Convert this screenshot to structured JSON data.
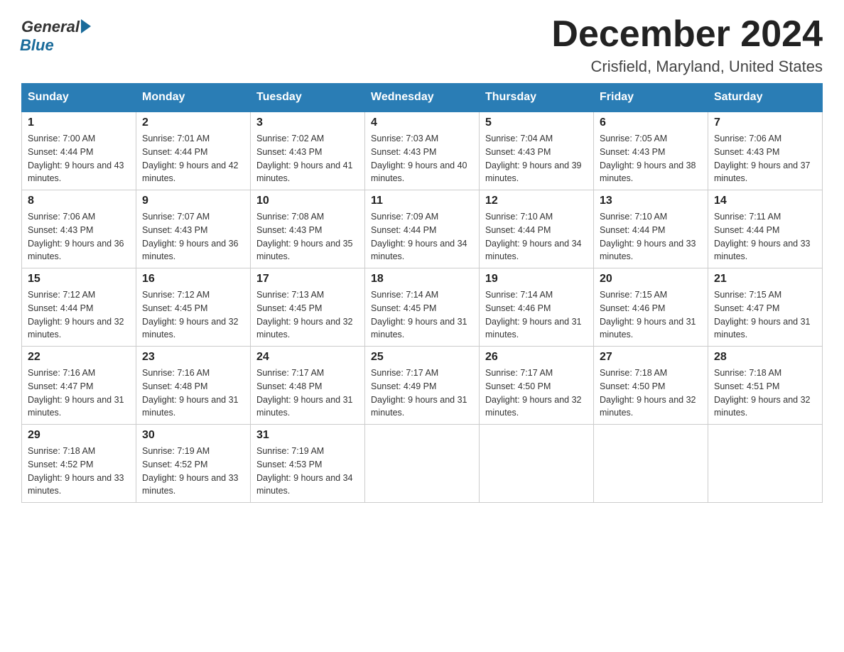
{
  "header": {
    "logo_general": "General",
    "logo_blue": "Blue",
    "month_title": "December 2024",
    "location": "Crisfield, Maryland, United States"
  },
  "days_of_week": [
    "Sunday",
    "Monday",
    "Tuesday",
    "Wednesday",
    "Thursday",
    "Friday",
    "Saturday"
  ],
  "weeks": [
    [
      {
        "day": "1",
        "sunrise": "7:00 AM",
        "sunset": "4:44 PM",
        "daylight": "9 hours and 43 minutes."
      },
      {
        "day": "2",
        "sunrise": "7:01 AM",
        "sunset": "4:44 PM",
        "daylight": "9 hours and 42 minutes."
      },
      {
        "day": "3",
        "sunrise": "7:02 AM",
        "sunset": "4:43 PM",
        "daylight": "9 hours and 41 minutes."
      },
      {
        "day": "4",
        "sunrise": "7:03 AM",
        "sunset": "4:43 PM",
        "daylight": "9 hours and 40 minutes."
      },
      {
        "day": "5",
        "sunrise": "7:04 AM",
        "sunset": "4:43 PM",
        "daylight": "9 hours and 39 minutes."
      },
      {
        "day": "6",
        "sunrise": "7:05 AM",
        "sunset": "4:43 PM",
        "daylight": "9 hours and 38 minutes."
      },
      {
        "day": "7",
        "sunrise": "7:06 AM",
        "sunset": "4:43 PM",
        "daylight": "9 hours and 37 minutes."
      }
    ],
    [
      {
        "day": "8",
        "sunrise": "7:06 AM",
        "sunset": "4:43 PM",
        "daylight": "9 hours and 36 minutes."
      },
      {
        "day": "9",
        "sunrise": "7:07 AM",
        "sunset": "4:43 PM",
        "daylight": "9 hours and 36 minutes."
      },
      {
        "day": "10",
        "sunrise": "7:08 AM",
        "sunset": "4:43 PM",
        "daylight": "9 hours and 35 minutes."
      },
      {
        "day": "11",
        "sunrise": "7:09 AM",
        "sunset": "4:44 PM",
        "daylight": "9 hours and 34 minutes."
      },
      {
        "day": "12",
        "sunrise": "7:10 AM",
        "sunset": "4:44 PM",
        "daylight": "9 hours and 34 minutes."
      },
      {
        "day": "13",
        "sunrise": "7:10 AM",
        "sunset": "4:44 PM",
        "daylight": "9 hours and 33 minutes."
      },
      {
        "day": "14",
        "sunrise": "7:11 AM",
        "sunset": "4:44 PM",
        "daylight": "9 hours and 33 minutes."
      }
    ],
    [
      {
        "day": "15",
        "sunrise": "7:12 AM",
        "sunset": "4:44 PM",
        "daylight": "9 hours and 32 minutes."
      },
      {
        "day": "16",
        "sunrise": "7:12 AM",
        "sunset": "4:45 PM",
        "daylight": "9 hours and 32 minutes."
      },
      {
        "day": "17",
        "sunrise": "7:13 AM",
        "sunset": "4:45 PM",
        "daylight": "9 hours and 32 minutes."
      },
      {
        "day": "18",
        "sunrise": "7:14 AM",
        "sunset": "4:45 PM",
        "daylight": "9 hours and 31 minutes."
      },
      {
        "day": "19",
        "sunrise": "7:14 AM",
        "sunset": "4:46 PM",
        "daylight": "9 hours and 31 minutes."
      },
      {
        "day": "20",
        "sunrise": "7:15 AM",
        "sunset": "4:46 PM",
        "daylight": "9 hours and 31 minutes."
      },
      {
        "day": "21",
        "sunrise": "7:15 AM",
        "sunset": "4:47 PM",
        "daylight": "9 hours and 31 minutes."
      }
    ],
    [
      {
        "day": "22",
        "sunrise": "7:16 AM",
        "sunset": "4:47 PM",
        "daylight": "9 hours and 31 minutes."
      },
      {
        "day": "23",
        "sunrise": "7:16 AM",
        "sunset": "4:48 PM",
        "daylight": "9 hours and 31 minutes."
      },
      {
        "day": "24",
        "sunrise": "7:17 AM",
        "sunset": "4:48 PM",
        "daylight": "9 hours and 31 minutes."
      },
      {
        "day": "25",
        "sunrise": "7:17 AM",
        "sunset": "4:49 PM",
        "daylight": "9 hours and 31 minutes."
      },
      {
        "day": "26",
        "sunrise": "7:17 AM",
        "sunset": "4:50 PM",
        "daylight": "9 hours and 32 minutes."
      },
      {
        "day": "27",
        "sunrise": "7:18 AM",
        "sunset": "4:50 PM",
        "daylight": "9 hours and 32 minutes."
      },
      {
        "day": "28",
        "sunrise": "7:18 AM",
        "sunset": "4:51 PM",
        "daylight": "9 hours and 32 minutes."
      }
    ],
    [
      {
        "day": "29",
        "sunrise": "7:18 AM",
        "sunset": "4:52 PM",
        "daylight": "9 hours and 33 minutes."
      },
      {
        "day": "30",
        "sunrise": "7:19 AM",
        "sunset": "4:52 PM",
        "daylight": "9 hours and 33 minutes."
      },
      {
        "day": "31",
        "sunrise": "7:19 AM",
        "sunset": "4:53 PM",
        "daylight": "9 hours and 34 minutes."
      },
      null,
      null,
      null,
      null
    ]
  ]
}
